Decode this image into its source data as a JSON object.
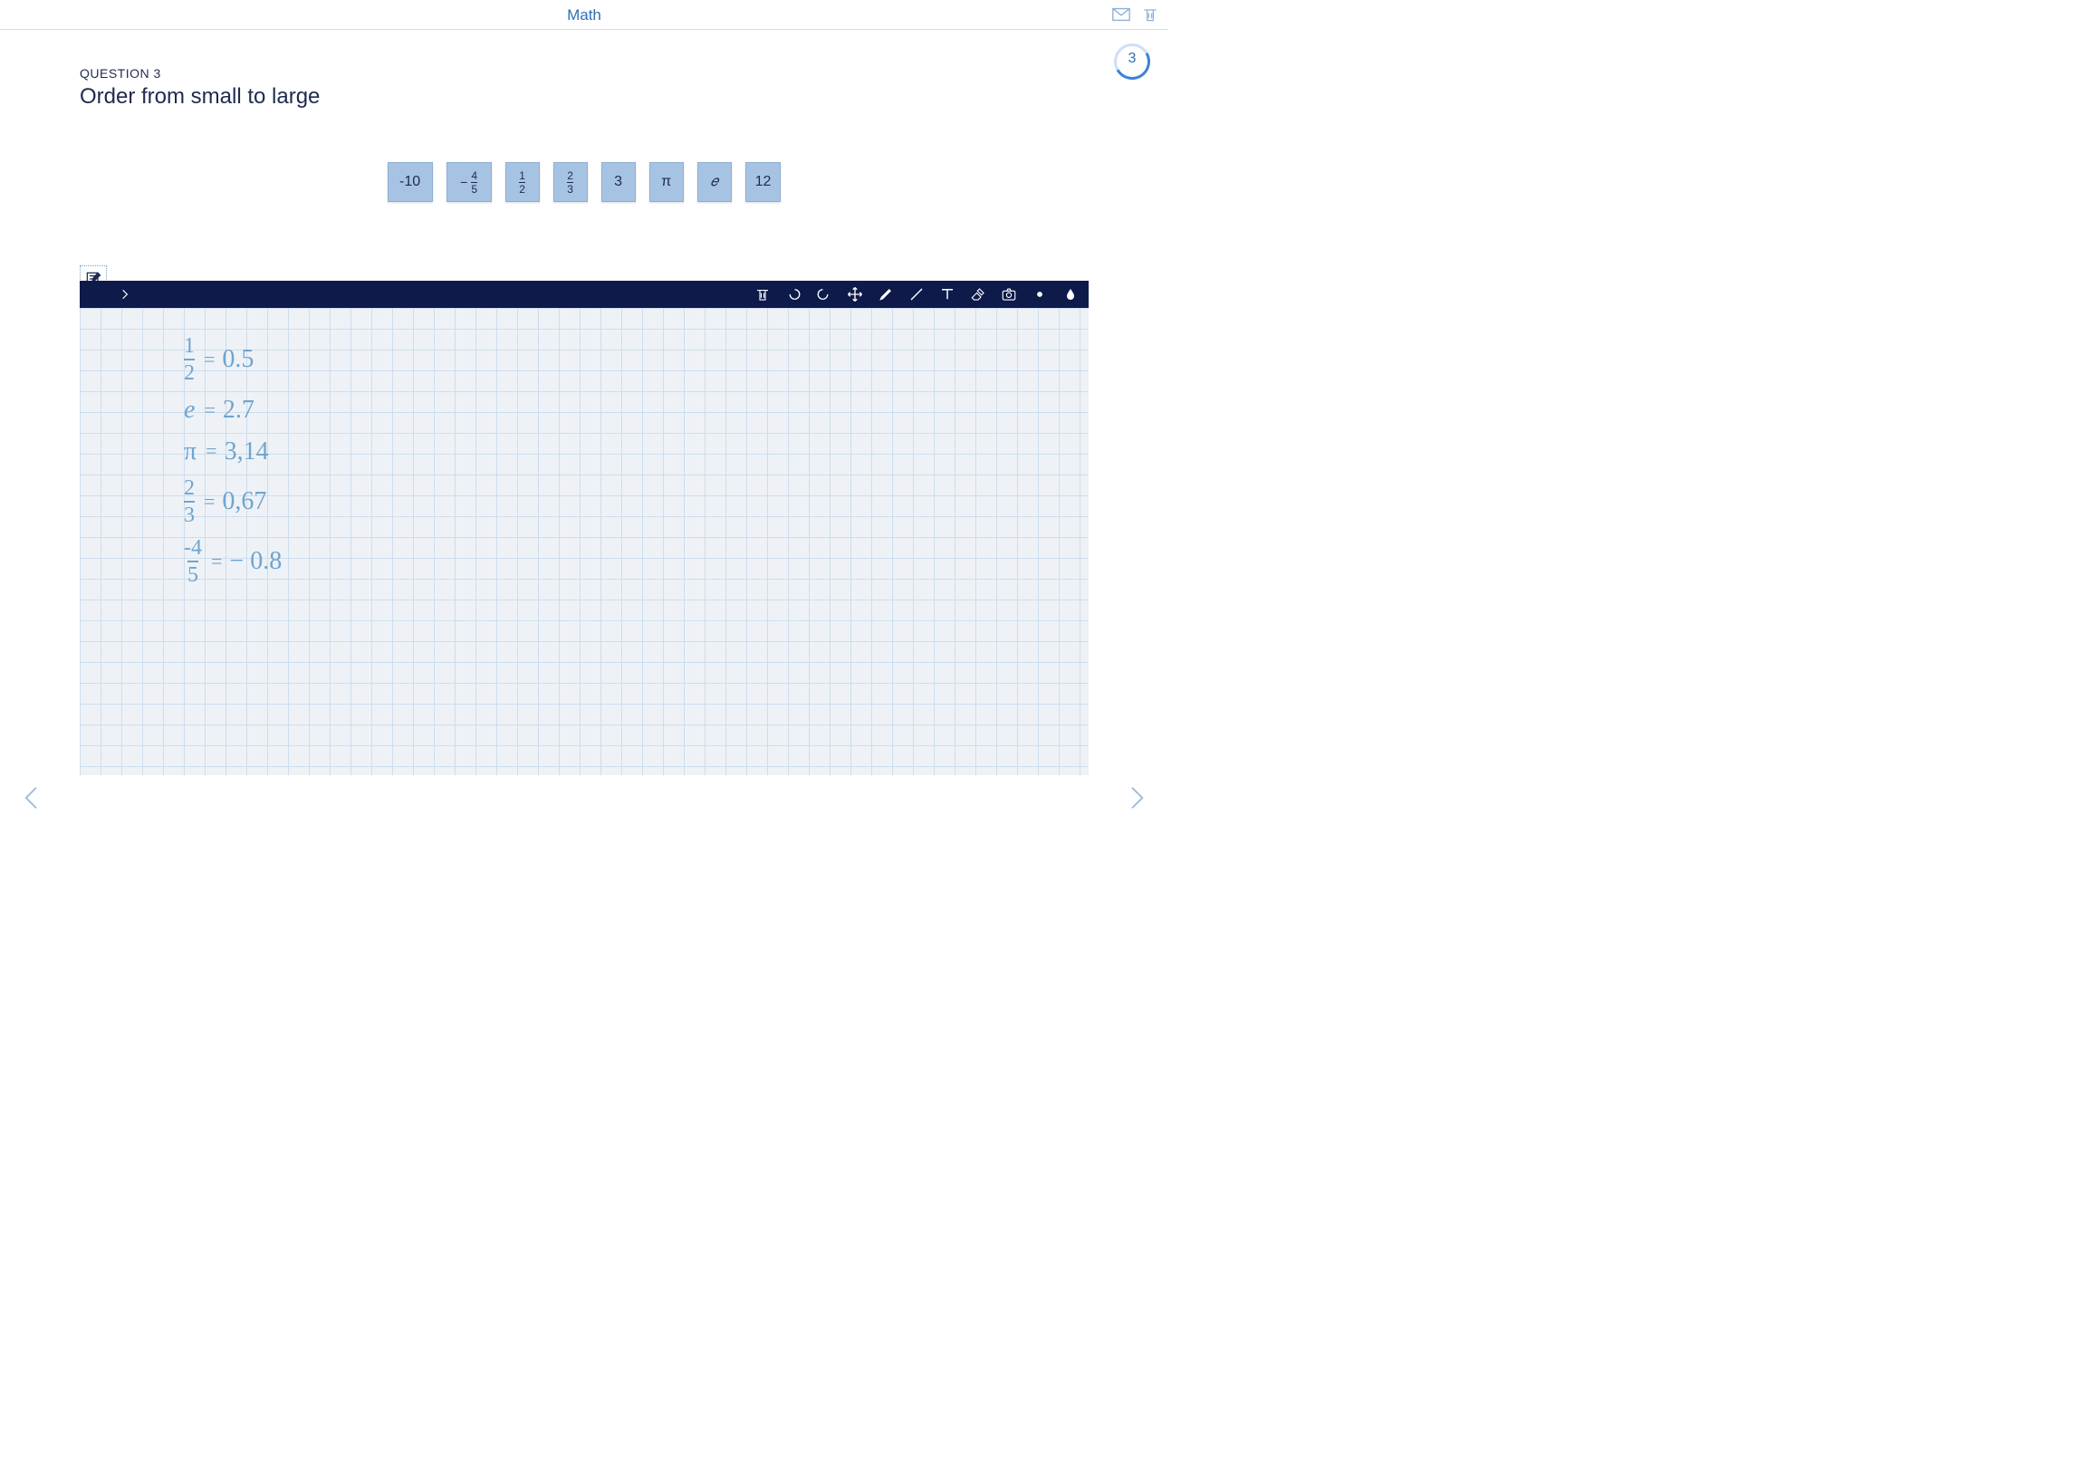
{
  "header": {
    "title": "Math"
  },
  "progress": {
    "current": "3"
  },
  "question": {
    "number_label": "QUESTION 3",
    "title": "Order from small to large"
  },
  "tiles": [
    {
      "display": "-10",
      "type": "plain"
    },
    {
      "display_num": "4",
      "display_den": "5",
      "sign": "−",
      "type": "negfrac"
    },
    {
      "display_num": "1",
      "display_den": "2",
      "type": "frac"
    },
    {
      "display_num": "2",
      "display_den": "3",
      "type": "frac"
    },
    {
      "display": "3",
      "type": "plain"
    },
    {
      "display": "π",
      "type": "plain"
    },
    {
      "display": "𝑒",
      "type": "plain"
    },
    {
      "display": "12",
      "type": "plain"
    }
  ],
  "toolbar_icons": {
    "collapse": "›",
    "trash": "trash-icon",
    "undo": "undo-icon",
    "redo": "redo-icon",
    "move": "move-icon",
    "brush": "brush-icon",
    "line": "line-icon",
    "text": "text-icon",
    "eraser": "eraser-icon",
    "camera": "camera-icon",
    "dot": "dot-icon",
    "drop": "drop-icon"
  },
  "handwriting": [
    {
      "left_num": "1",
      "left_den": "2",
      "right": "0.5",
      "type": "frac"
    },
    {
      "left": "e",
      "right": "2.7",
      "type": "sym"
    },
    {
      "left": "π",
      "right": "3,14",
      "type": "sym"
    },
    {
      "left_num": "2",
      "left_den": "3",
      "right": "0,67",
      "type": "frac"
    },
    {
      "left_num": "-4",
      "left_den": "5",
      "right": "− 0.8",
      "type": "frac"
    }
  ]
}
